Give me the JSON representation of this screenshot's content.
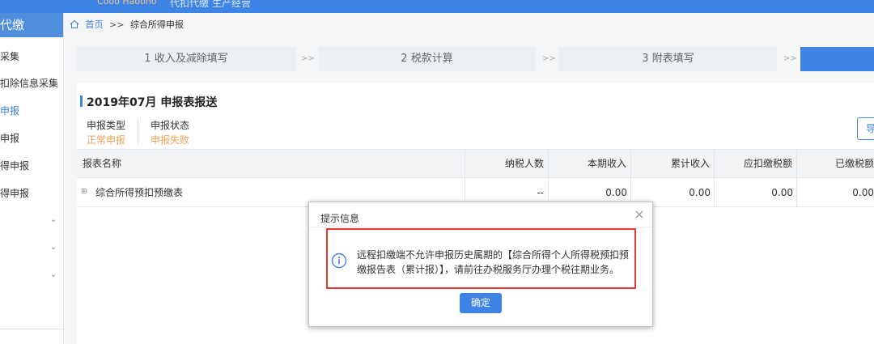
{
  "header": {
    "system_name": "Cooo Haoono",
    "tab_primary": "代扣代缴",
    "tab_secondary": "生产经营"
  },
  "sidebar": {
    "title": "代缴",
    "items": [
      {
        "label": "采集"
      },
      {
        "label": "扣除信息采集"
      },
      {
        "label": "申报"
      },
      {
        "label": "申报"
      },
      {
        "label": "得申报"
      },
      {
        "label": "得申报"
      }
    ]
  },
  "breadcrumb": {
    "home": "首页",
    "separator": ">>",
    "current": "综合所得申报"
  },
  "steps": [
    {
      "label": "1 收入及减除填写"
    },
    {
      "label": "2 税款计算"
    },
    {
      "label": "3 附表填写"
    },
    {
      "label": ""
    }
  ],
  "step_separator": ">>",
  "panel": {
    "title": "2019年07月  申报表报送",
    "report_type_label": "申报类型",
    "report_type_value": "正常申报",
    "report_status_label": "申报状态",
    "report_status_value": "申报失败",
    "export_label": "导"
  },
  "table": {
    "columns": [
      "报表名称",
      "纳税人数",
      "本期收入",
      "累计收入",
      "应扣缴税额",
      "已缴税额"
    ],
    "rows": [
      {
        "name": "综合所得预扣预缴表",
        "taxpayers": "--",
        "current_income": "0.00",
        "cumulative_income": "0.00",
        "tax_payable": "0.00",
        "tax_paid": "0.00"
      }
    ]
  },
  "dialog": {
    "title": "提示信息",
    "message": "远程扣缴端不允许申报历史属期的【综合所得个人所得税预扣预缴报告表（累计报）】，请前往办税服务厅办理个税往期业务。",
    "confirm_label": "确定"
  },
  "colors": {
    "accent": "#3e83e6",
    "warning_text": "#f0a25a",
    "highlight_border": "#e53935"
  }
}
